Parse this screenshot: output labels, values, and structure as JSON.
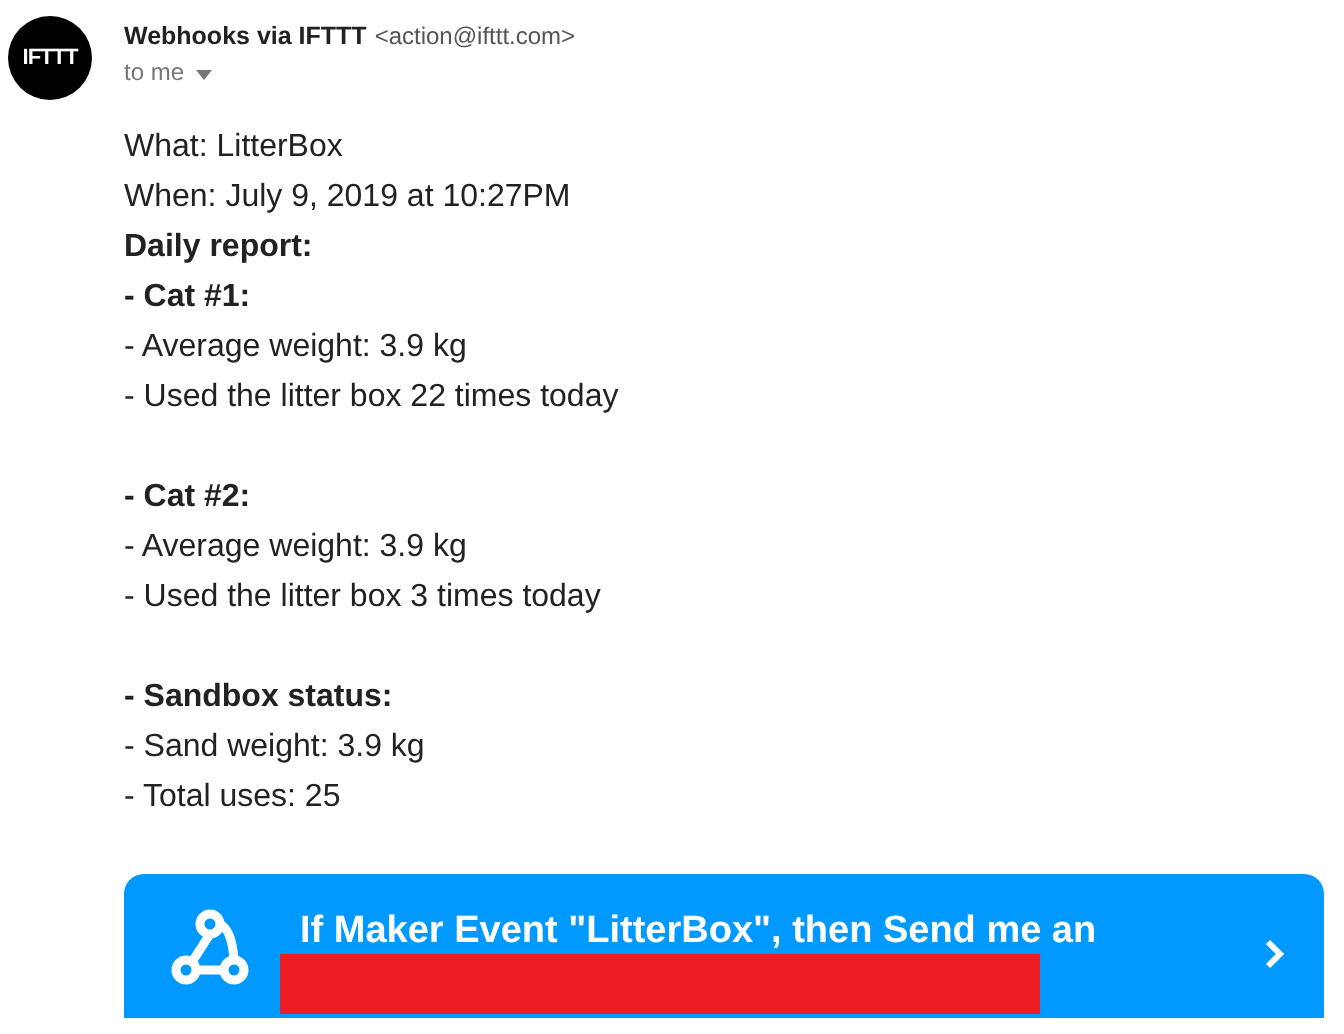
{
  "avatar": {
    "text": "IFTTT"
  },
  "sender": {
    "name": "Webhooks via IFTTT",
    "address": "<action@ifttt.com>",
    "recipient": "to me"
  },
  "body": [
    [
      {
        "text": "What: LitterBox",
        "bold": false
      },
      {
        "text": "When: July 9, 2019 at 10:27PM",
        "bold": false
      },
      {
        "text": "Daily report:",
        "bold": true
      },
      {
        "text": "- Cat #1:",
        "bold": true
      },
      {
        "text": "- Average weight: 3.9 kg",
        "bold": false
      },
      {
        "text": "- Used the litter box 22 times today",
        "bold": false
      }
    ],
    [
      {
        "text": "- Cat #2:",
        "bold": true
      },
      {
        "text": "- Average weight: 3.9 kg",
        "bold": false
      },
      {
        "text": "- Used the litter box 3 times today",
        "bold": false
      }
    ],
    [
      {
        "text": "- Sandbox status:",
        "bold": true
      },
      {
        "text": "- Sand weight: 3.9 kg",
        "bold": false
      },
      {
        "text": "- Total uses: 25",
        "bold": false
      }
    ]
  ],
  "applet": {
    "title": "If Maker Event \"LitterBox\", then Send me an"
  }
}
